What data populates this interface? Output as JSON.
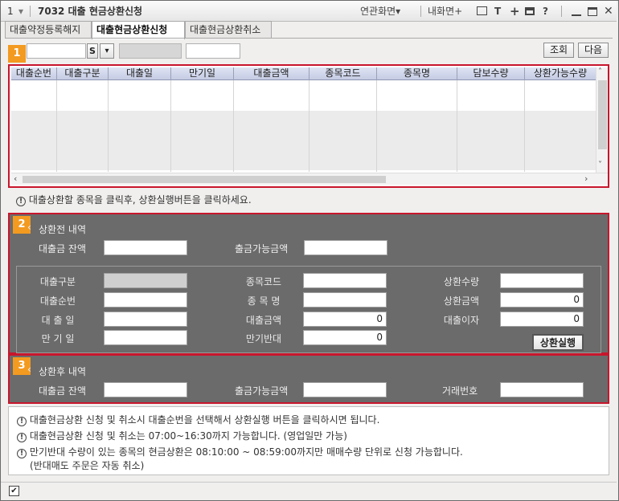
{
  "window": {
    "number": "1",
    "title": "7032 대출 현금상환신청",
    "links_label": "연관화면",
    "my_screen_label": "내화면+",
    "buttons": {
      "text": "T",
      "plus": "+",
      "help": "?"
    }
  },
  "tabs": [
    {
      "label": "대출약정등록해지"
    },
    {
      "label": "대출현금상환신청"
    },
    {
      "label": "대출현금상환취소"
    }
  ],
  "toolbar": {
    "badge": "1",
    "account_value": "",
    "account_suffix": "S",
    "query_button": "조회",
    "next_button": "다음"
  },
  "grid": {
    "columns": [
      "대출순번",
      "대출구분",
      "대출일",
      "만기일",
      "대출금액",
      "종목코드",
      "종목명",
      "담보수량",
      "상환가능수량"
    ]
  },
  "notice_top": "대출상환할 종목을 클릭후, 상환실행버튼을 클릭하세요.",
  "section2": {
    "badge": "2",
    "title": "상환전 내역",
    "loan_balance_label": "대출금 잔액",
    "withdrawable_label": "출금가능금액",
    "fields": {
      "loan_type_label": "대출구분",
      "loan_seq_label": "대출순번",
      "loan_date_label": "대 출 일",
      "maturity_label": "만 기 일",
      "stock_code_label": "종목코드",
      "stock_name_label": "종 목 명",
      "loan_amount_label": "대출금액",
      "maturity_opposite_label": "만기반대",
      "repay_qty_label": "상환수량",
      "repay_amount_label": "상환금액",
      "loan_interest_label": "대출이자",
      "loan_amount_value": "0",
      "maturity_opposite_value": "0",
      "repay_amount_value": "0",
      "loan_interest_value": "0"
    },
    "execute_button": "상환실행"
  },
  "section3": {
    "badge": "3",
    "title": "상환후 내역",
    "loan_balance_label": "대출금 잔액",
    "withdrawable_label": "출금가능금액",
    "trade_no_label": "거래번호"
  },
  "info": [
    "대출현금상환 신청 및 취소시 대출순번을 선택해서 상환실행 버튼을 클릭하시면 됩니다.",
    "대출현금상환 신청 및 취소는 07:00~16:30까지 가능합니다. (영업일만 가능)",
    "만기반대 수량이 있는 종목의 현금상환은 08:10:00 ~ 08:59:00까지만 매매수량 단위로 신청 가능합니다.",
    "(반대매도 주문은 자동 취소)"
  ],
  "info_icon": "!",
  "status": {
    "check": "✔"
  }
}
